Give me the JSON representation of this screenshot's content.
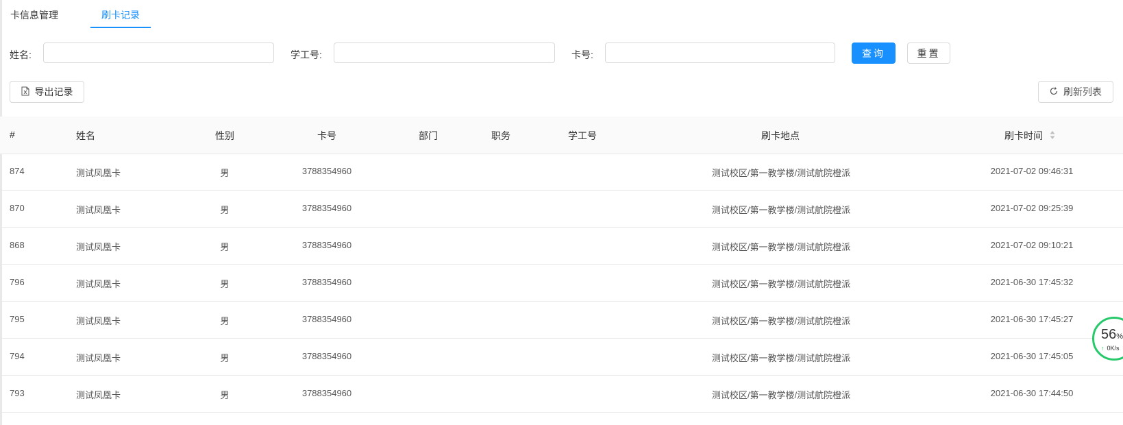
{
  "tabs": [
    {
      "label": "卡信息管理",
      "active": false
    },
    {
      "label": "刷卡记录",
      "active": true
    }
  ],
  "search": {
    "name_label": "姓名:",
    "name_value": "",
    "id_label": "学工号:",
    "id_value": "",
    "card_label": "卡号:",
    "card_value": "",
    "query_button": "查询",
    "reset_button": "重置"
  },
  "toolbar": {
    "export_label": "导出记录",
    "refresh_label": "刷新列表"
  },
  "table": {
    "columns": [
      "#",
      "姓名",
      "性别",
      "卡号",
      "部门",
      "职务",
      "学工号",
      "刷卡地点",
      "刷卡时间"
    ],
    "rows": [
      {
        "id": "874",
        "name": "测试凤凰卡",
        "gender": "男",
        "card": "3788354960",
        "dept": "",
        "position": "",
        "staff_id": "",
        "location": "测试校区/第一教学楼/测试航院橙派",
        "time": "2021-07-02 09:46:31"
      },
      {
        "id": "870",
        "name": "测试凤凰卡",
        "gender": "男",
        "card": "3788354960",
        "dept": "",
        "position": "",
        "staff_id": "",
        "location": "测试校区/第一教学楼/测试航院橙派",
        "time": "2021-07-02 09:25:39"
      },
      {
        "id": "868",
        "name": "测试凤凰卡",
        "gender": "男",
        "card": "3788354960",
        "dept": "",
        "position": "",
        "staff_id": "",
        "location": "测试校区/第一教学楼/测试航院橙派",
        "time": "2021-07-02 09:10:21"
      },
      {
        "id": "796",
        "name": "测试凤凰卡",
        "gender": "男",
        "card": "3788354960",
        "dept": "",
        "position": "",
        "staff_id": "",
        "location": "测试校区/第一教学楼/测试航院橙派",
        "time": "2021-06-30 17:45:32"
      },
      {
        "id": "795",
        "name": "测试凤凰卡",
        "gender": "男",
        "card": "3788354960",
        "dept": "",
        "position": "",
        "staff_id": "",
        "location": "测试校区/第一教学楼/测试航院橙派",
        "time": "2021-06-30 17:45:27"
      },
      {
        "id": "794",
        "name": "测试凤凰卡",
        "gender": "男",
        "card": "3788354960",
        "dept": "",
        "position": "",
        "staff_id": "",
        "location": "测试校区/第一教学楼/测试航院橙派",
        "time": "2021-06-30 17:45:05"
      },
      {
        "id": "793",
        "name": "测试凤凰卡",
        "gender": "男",
        "card": "3788354960",
        "dept": "",
        "position": "",
        "staff_id": "",
        "location": "测试校区/第一教学楼/测试航院橙派",
        "time": "2021-06-30 17:44:50"
      }
    ]
  },
  "speed_widget": {
    "percent": "56",
    "percent_unit": "%",
    "rate": "0K/s"
  },
  "icons": {
    "export": "excel-file-icon",
    "refresh": "refresh-icon",
    "sort": "sort-caret-icon"
  },
  "colors": {
    "primary": "#1890ff",
    "speed_ring": "#27c96b"
  }
}
